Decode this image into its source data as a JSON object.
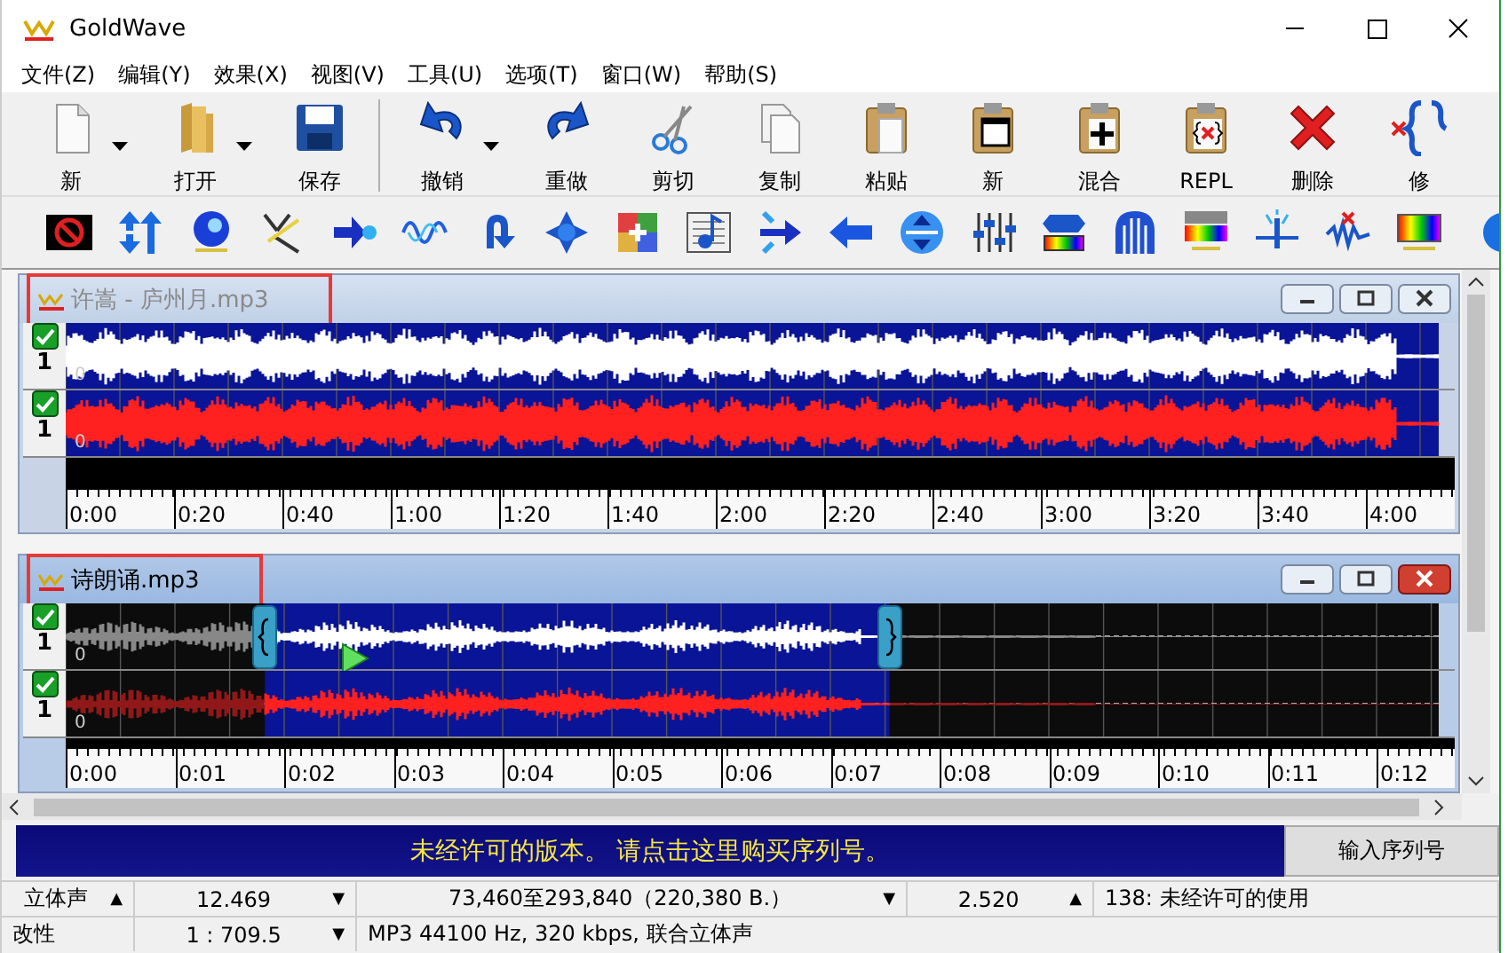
{
  "window": {
    "title": "GoldWave"
  },
  "menu": [
    "文件(Z)",
    "编辑(Y)",
    "效果(X)",
    "视图(V)",
    "工具(U)",
    "选项(T)",
    "窗口(W)",
    "帮助(S)"
  ],
  "toolbar": [
    {
      "kind": "page",
      "label": "新"
    },
    {
      "kind": "dropdown"
    },
    {
      "kind": "folder",
      "label": "打开"
    },
    {
      "kind": "dropdown"
    },
    {
      "kind": "disk",
      "label": "保存"
    },
    {
      "kind": "separator"
    },
    {
      "kind": "undo",
      "label": "撤销"
    },
    {
      "kind": "dropdown"
    },
    {
      "kind": "redo",
      "label": "重做"
    },
    {
      "kind": "scissors",
      "label": "剪切"
    },
    {
      "kind": "copy",
      "label": "复制"
    },
    {
      "kind": "paste",
      "label": "粘贴"
    },
    {
      "kind": "window",
      "label": "新"
    },
    {
      "kind": "mix",
      "label": "混合"
    },
    {
      "kind": "repl",
      "label": "REPL"
    },
    {
      "kind": "delete",
      "label": "删除"
    },
    {
      "kind": "trim",
      "label": "修"
    }
  ],
  "effects_toolbar": [
    {
      "kind": "stop"
    },
    {
      "kind": "updown"
    },
    {
      "kind": "sphere"
    },
    {
      "kind": "cross"
    },
    {
      "kind": "merge"
    },
    {
      "kind": "sine"
    },
    {
      "kind": "uturn"
    },
    {
      "kind": "star"
    },
    {
      "kind": "colorbox"
    },
    {
      "kind": "note"
    },
    {
      "kind": "split"
    },
    {
      "kind": "left"
    },
    {
      "kind": "circle"
    },
    {
      "kind": "sliders"
    },
    {
      "kind": "chevron"
    },
    {
      "kind": "arch"
    },
    {
      "kind": "spectrum"
    },
    {
      "kind": "spike"
    },
    {
      "kind": "xwave"
    },
    {
      "kind": "rainbow"
    },
    {
      "kind": "halfcircle"
    }
  ],
  "documents": [
    {
      "title": "许嵩 - 庐州月.mp3",
      "active": false,
      "annotated": true,
      "selection_visible": false,
      "channels": [
        {
          "enabled": true,
          "number": "1",
          "axis_label": "0",
          "color": "#ffffff"
        },
        {
          "enabled": true,
          "number": "1",
          "axis_label": "0",
          "color": "#ff2020"
        }
      ],
      "ruler": [
        "0:00",
        "0:20",
        "0:40",
        "1:00",
        "1:20",
        "1:40",
        "2:00",
        "2:20",
        "2:40",
        "3:00",
        "3:20",
        "3:40",
        "4:00"
      ]
    },
    {
      "title": "诗朗诵.mp3",
      "active": true,
      "annotated": true,
      "selection_visible": true,
      "channels": [
        {
          "enabled": true,
          "number": "1",
          "axis_label": "0",
          "color": "#ffffff"
        },
        {
          "enabled": true,
          "number": "1",
          "axis_label": "0",
          "color": "#ff2020"
        }
      ],
      "ruler": [
        "0:00",
        "0:01",
        "0:02",
        "0:03",
        "0:04",
        "0:05",
        "0:06",
        "0:07",
        "0:08",
        "0:09",
        "0:10",
        "0:11",
        "0:12"
      ]
    }
  ],
  "banner": {
    "message": "未经许可的版本。 请点击这里购买序列号。",
    "button": "输入序列号"
  },
  "status_bar": [
    [
      {
        "text": "立体声",
        "caret": "▲"
      },
      {
        "text": "12.469",
        "caret": "▼"
      },
      {
        "text": "73,460至293,840（220,380 B.）",
        "caret": "▼"
      },
      {
        "text": "2.520",
        "caret": "▲"
      },
      {
        "text": "138: 未经许可的使用"
      }
    ],
    [
      {
        "text": "改性"
      },
      {
        "text": "1 : 709.5",
        "caret": "▼"
      },
      {
        "text": "MP3 44100 Hz, 320 kbps, 联合立体声"
      }
    ]
  ]
}
